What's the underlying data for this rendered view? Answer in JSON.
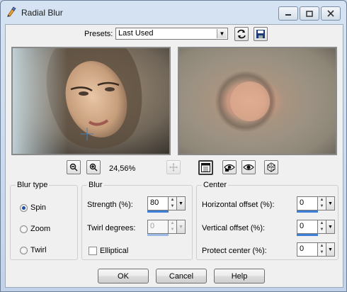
{
  "window": {
    "title": "Radial Blur"
  },
  "presets": {
    "label": "Presets:",
    "value": "Last Used"
  },
  "zoom": {
    "level": "24,56%"
  },
  "blur_type": {
    "title": "Blur type",
    "options": [
      "Spin",
      "Zoom",
      "Twirl"
    ],
    "selected": "Spin"
  },
  "blur": {
    "title": "Blur",
    "strength_label": "Strength (%):",
    "strength_value": "80",
    "twirl_label": "Twirl degrees:",
    "twirl_value": "0",
    "elliptical_label": "Elliptical",
    "elliptical_checked": false
  },
  "center": {
    "title": "Center",
    "horizontal_label": "Horizontal offset (%):",
    "horizontal_value": "0",
    "vertical_label": "Vertical offset (%):",
    "vertical_value": "0",
    "protect_label": "Protect center (%):",
    "protect_value": "0"
  },
  "buttons": {
    "ok": "OK",
    "cancel": "Cancel",
    "help": "Help"
  },
  "colors": {
    "accent": "#3d7fd6",
    "titlebar": "#c8d7ea"
  }
}
